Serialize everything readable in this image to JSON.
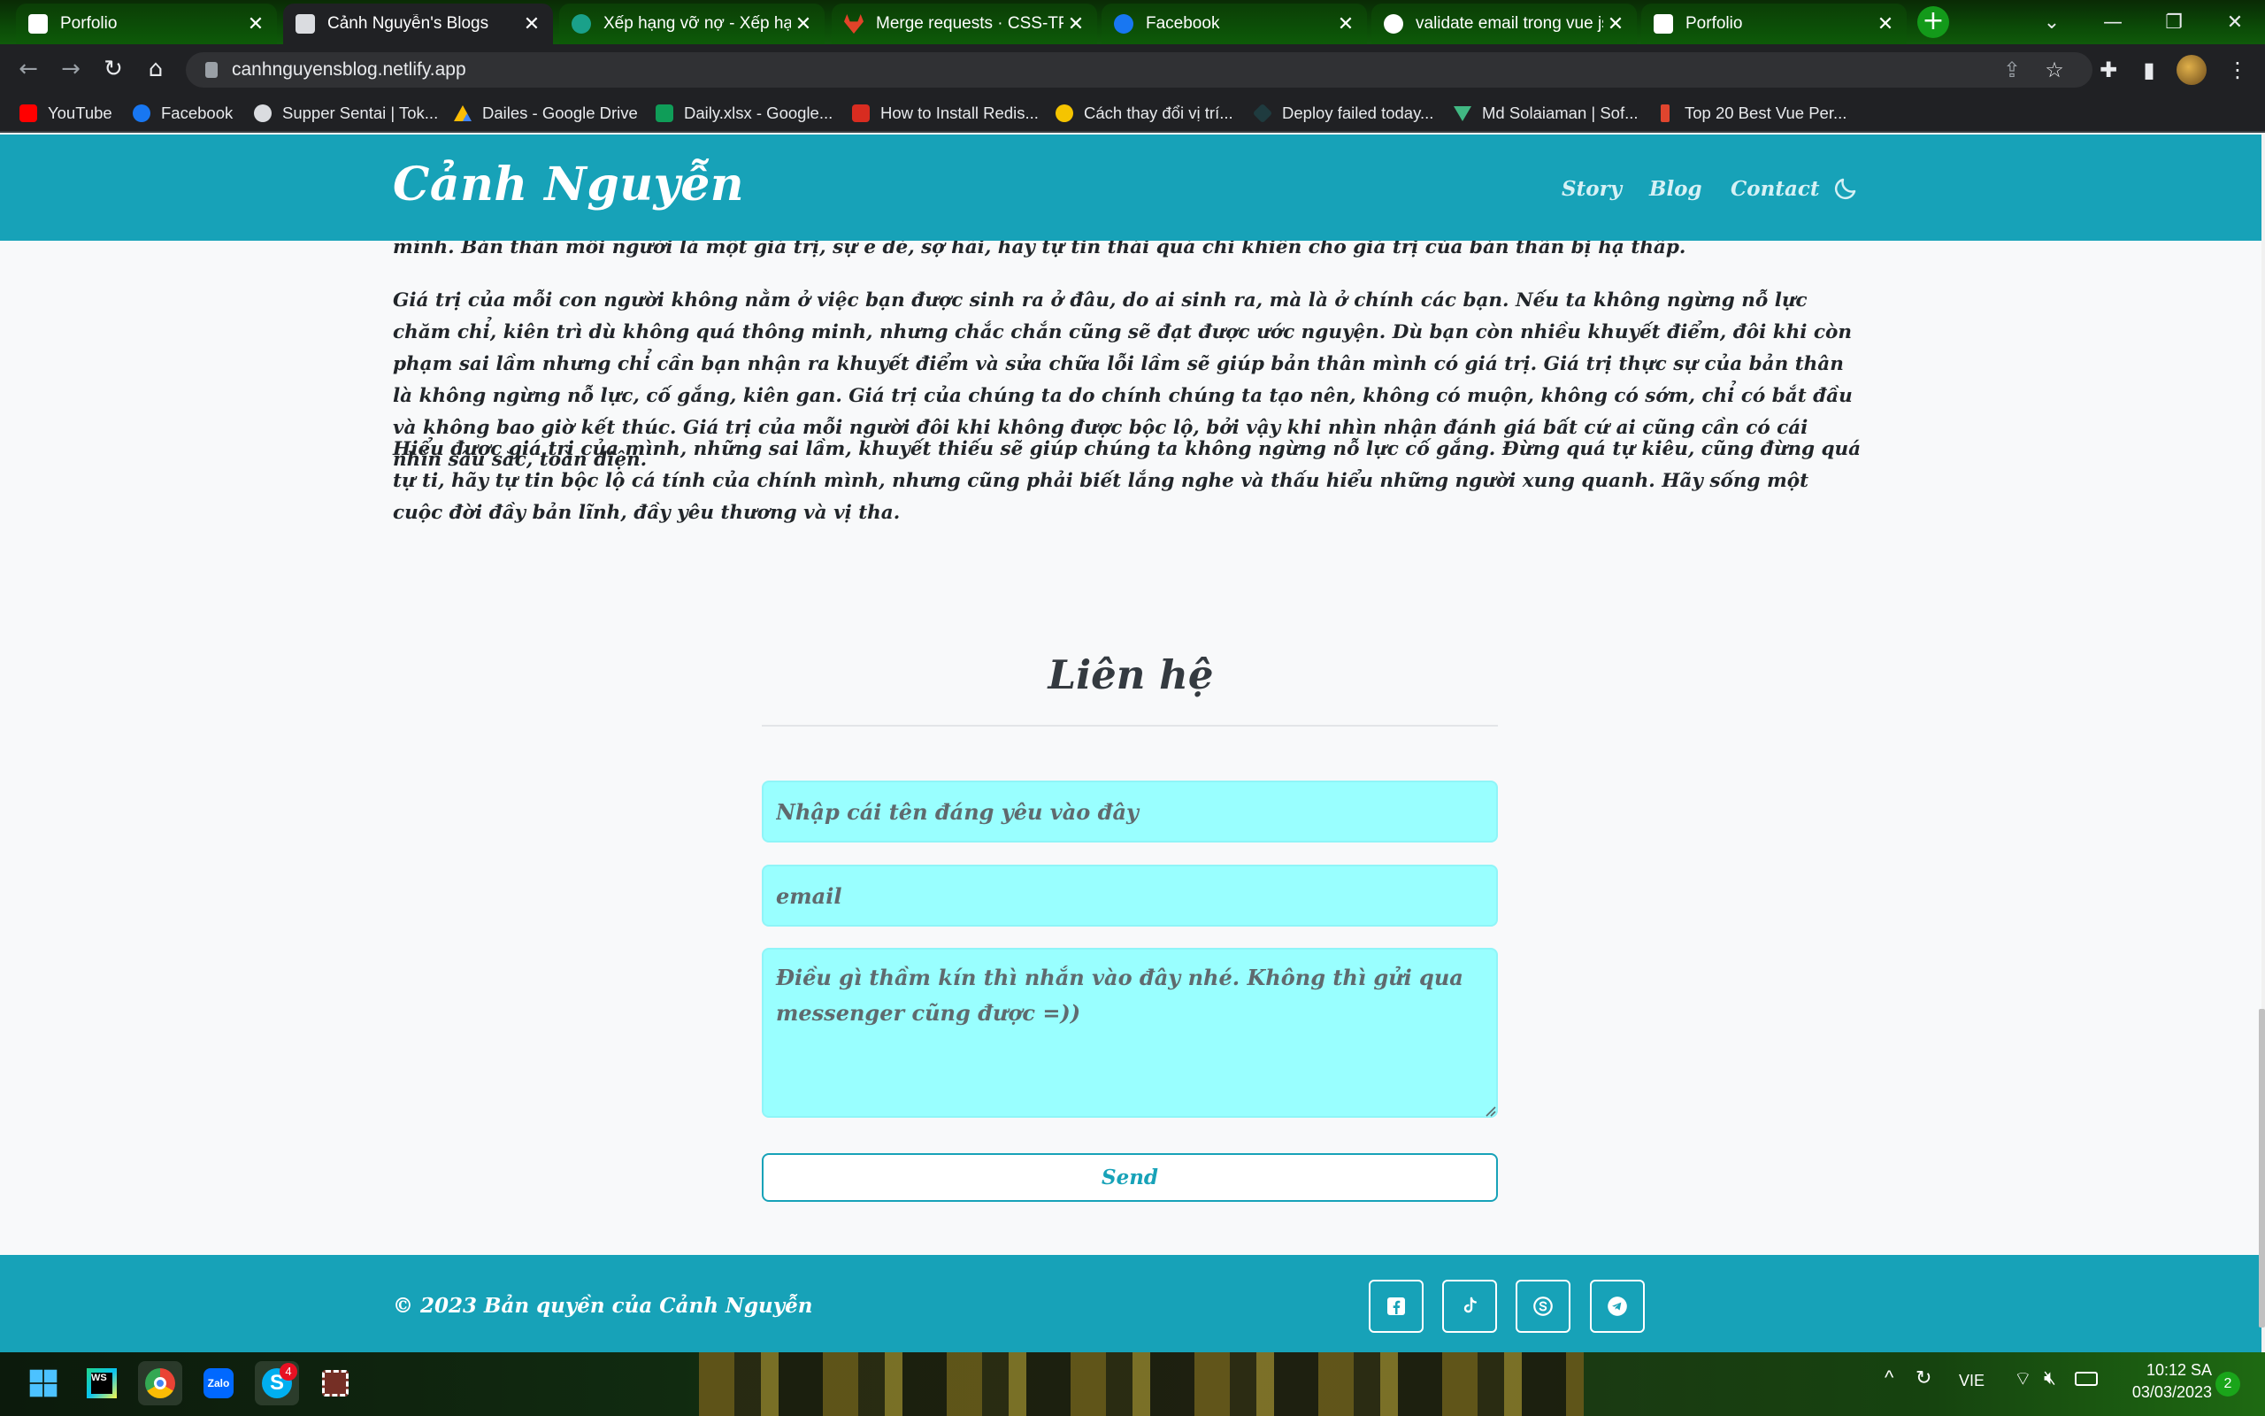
{
  "browser": {
    "tabs": [
      {
        "title": "Porfolio",
        "active": false
      },
      {
        "title": "Cảnh Nguyễn's Blogs",
        "active": true
      },
      {
        "title": "Xếp hạng vỡ nợ - Xếp hạng",
        "active": false
      },
      {
        "title": "Merge requests · CSS-TPB",
        "active": false
      },
      {
        "title": "Facebook",
        "active": false
      },
      {
        "title": "validate email trong vue js",
        "active": false
      },
      {
        "title": "Porfolio",
        "active": false
      }
    ],
    "close_glyph": "✕",
    "new_tab_glyph": "+",
    "url": "canhnguyensblog.netlify.app",
    "bookmarks": [
      {
        "label": "YouTube",
        "icon": "youtube-icon",
        "color": "#ff0000"
      },
      {
        "label": "Facebook",
        "icon": "facebook-icon",
        "color": "#1877f2"
      },
      {
        "label": "Supper Sentai | Tok...",
        "icon": "globe-icon",
        "color": "#dadce0"
      },
      {
        "label": "Dailes - Google Drive",
        "icon": "google-drive-icon",
        "color": "#fbbc04"
      },
      {
        "label": "Daily.xlsx - Google...",
        "icon": "google-sheets-icon",
        "color": "#0f9d58"
      },
      {
        "label": "How to Install Redis...",
        "icon": "redis-icon",
        "color": "#d82c20"
      },
      {
        "label": "Cách thay đổi vị trí...",
        "icon": "yellow-circle-icon",
        "color": "#f5c400"
      },
      {
        "label": "Deploy failed today...",
        "icon": "netlify-icon",
        "color": "#1f3b3f"
      },
      {
        "label": "Md Solaiaman | Sof...",
        "icon": "vuetify-icon",
        "color": "#41b883"
      },
      {
        "label": "Top 20 Best Vue Per...",
        "icon": "j-icon",
        "color": "#e0452e"
      }
    ]
  },
  "site": {
    "brand": "Cảnh Nguyễn",
    "nav": [
      "Story",
      "Blog",
      "Contact"
    ],
    "paragraphs": [
      "mình. Bản thân mỗi người là một giá trị, sự e dè, sợ hãi, hay tự tin thái quá chỉ khiến cho giá trị của bản thân bị hạ thấp.",
      "Giá trị của mỗi con người không nằm ở việc bạn được sinh ra ở đâu, do ai sinh ra, mà là ở chính các bạn. Nếu ta không ngừng nỗ lực chăm chỉ, kiên trì dù không quá thông minh, nhưng chắc chắn cũng sẽ đạt được ước nguyện. Dù bạn còn nhiều khuyết điểm, đôi khi còn phạm sai lầm nhưng chỉ cần bạn nhận ra khuyết điểm và sửa chữa lỗi lầm sẽ giúp bản thân mình có giá trị. Giá trị thực sự của bản thân là không ngừng nỗ lực, cố gắng, kiên gan. Giá trị của chúng ta do chính chúng ta tạo nên, không có muộn, không có sớm, chỉ có bắt đầu và không bao giờ kết thúc. Giá trị của mỗi người đôi khi không được bộc lộ, bởi vậy khi nhìn nhận đánh giá bất cứ ai cũng cần có cái nhìn sâu sắc, toàn diện.",
      "Hiểu được giá trị của mình, những sai lầm, khuyết thiếu sẽ giúp chúng ta không ngừng nỗ lực cố gắng. Đừng quá tự kiêu, cũng đừng quá tự ti, hãy tự tin bộc lộ cá tính của chính mình, nhưng cũng phải biết lắng nghe và thấu hiểu những người xung quanh. Hãy sống một cuộc đời đầy bản lĩnh, đầy yêu thương và vị tha."
    ],
    "contact": {
      "title": "Liên hệ",
      "name_placeholder": "Nhập cái tên đáng yêu vào đây",
      "email_placeholder": "email",
      "message_placeholder": "Điều gì thầm kín thì nhắn vào đây nhé. Không thì gửi qua messenger cũng được =))",
      "send_label": "Send"
    },
    "footer": {
      "copyright": "© 2023 Bản quyền của Cảnh Nguyễn",
      "social": [
        "facebook-icon",
        "tiktok-icon",
        "skype-icon",
        "telegram-icon"
      ]
    }
  },
  "taskbar": {
    "apps": [
      "windows-start-icon",
      "webstorm-icon",
      "chrome-icon",
      "zalo-icon",
      "skype-icon",
      "snipping-tool-icon"
    ],
    "skype_badge": "4",
    "language": "VIE",
    "time": "10:12 SA",
    "date": "03/03/2023",
    "notifications": "2"
  },
  "colors": {
    "accent": "#17a2b8",
    "input_bg": "#99ffff"
  }
}
